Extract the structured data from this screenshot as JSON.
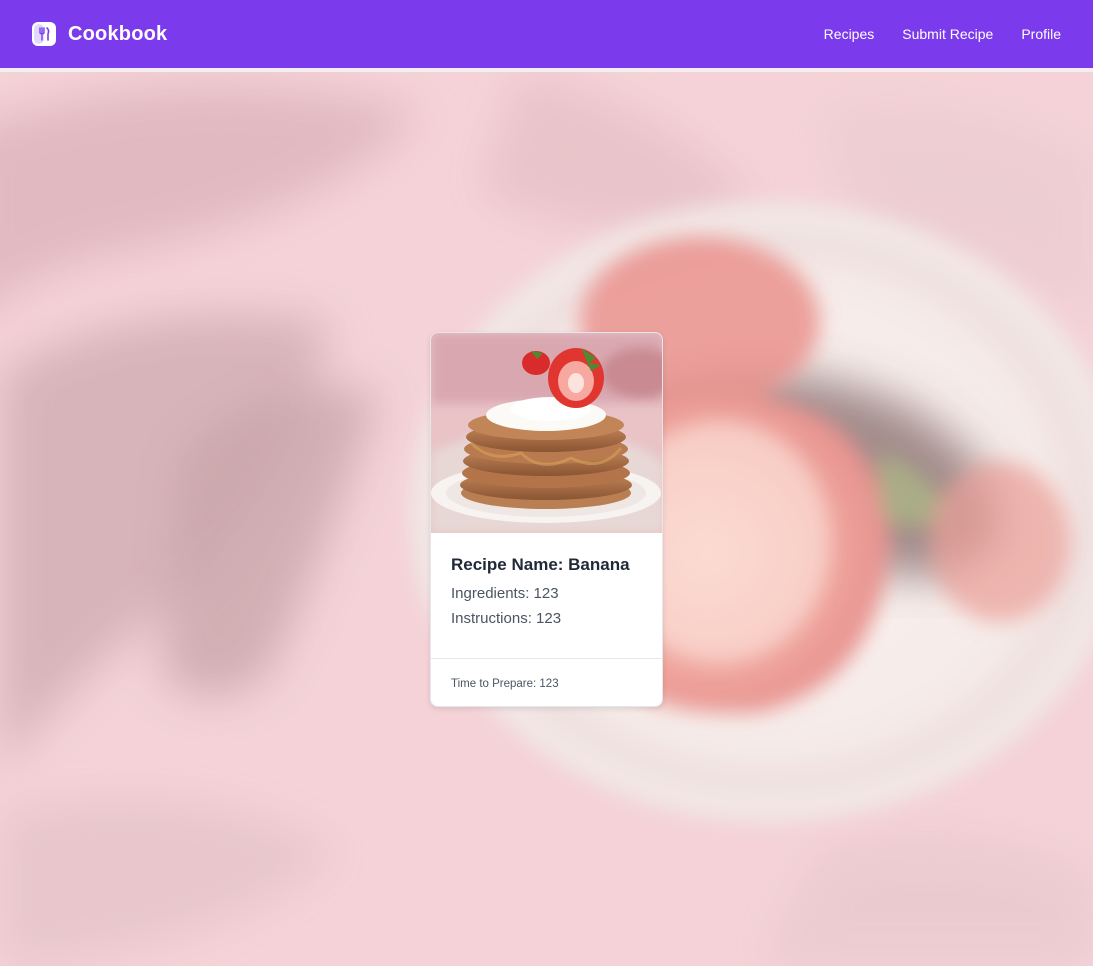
{
  "brand": {
    "name": "Cookbook",
    "logo_icon": "utensils-icon"
  },
  "nav": {
    "links": [
      {
        "label": "Recipes"
      },
      {
        "label": "Submit Recipe"
      },
      {
        "label": "Profile"
      }
    ]
  },
  "colors": {
    "navbar": "#7c3aed",
    "background_tint": "#f2c9cf"
  },
  "recipe_card": {
    "image_icon": "pancake-stack-photo",
    "title": "Recipe Name: Banana",
    "ingredients": "Ingredients: 123",
    "instructions": "Instructions: 123",
    "time": "Time to Prepare: 123"
  }
}
